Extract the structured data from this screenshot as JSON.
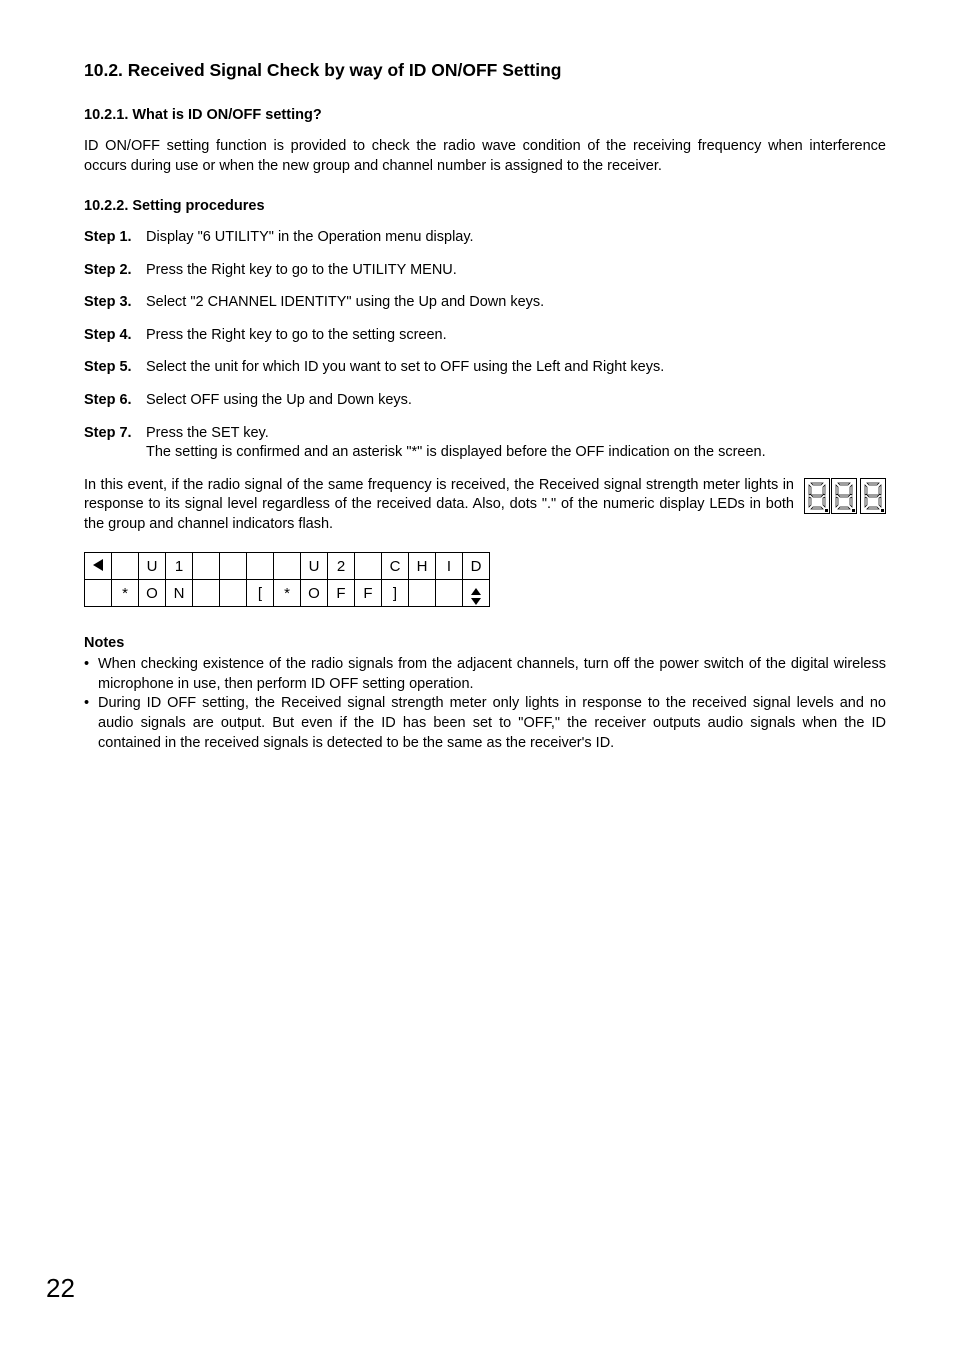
{
  "section_title": "10.2. Received Signal Check by way of ID ON/OFF Setting",
  "sub1": {
    "heading": "10.2.1. What is ID ON/OFF setting?",
    "text": "ID ON/OFF setting function is provided to check the radio wave condition of the receiving frequency when interference occurs during use or when the new group and channel number is assigned to the receiver."
  },
  "sub2": {
    "heading": "10.2.2. Setting procedures",
    "steps": [
      {
        "label": "Step 1.",
        "text": "Display \"6 UTILITY\" in the Operation menu display."
      },
      {
        "label": "Step 2.",
        "text": "Press the Right key to go to the UTILITY MENU."
      },
      {
        "label": "Step 3.",
        "text": "Select \"2 CHANNEL IDENTITY\" using the Up and Down keys."
      },
      {
        "label": "Step 4.",
        "text": "Press the Right key to go to the setting screen."
      },
      {
        "label": "Step 5.",
        "text": "Select the unit for which ID you want to set to OFF using the Left and Right keys."
      },
      {
        "label": "Step 6.",
        "text": "Select OFF using the Up and Down keys."
      },
      {
        "label": "Step 7.",
        "text": "Press the SET key.",
        "extra": "The setting is confirmed and an asterisk \"*\" is displayed before the OFF indication on the screen."
      }
    ],
    "after_text": "In this event, if the radio signal of the same frequency is received, the Received signal strength meter lights in response to its signal level regardless of the received data. Also, dots \".\" of the numeric display LEDs in both the group and channel indicators flash."
  },
  "lcd": {
    "row1": [
      "◀",
      "",
      "U",
      "1",
      "",
      "",
      "",
      "",
      "U",
      "2",
      "",
      "C",
      "H",
      "I",
      "D"
    ],
    "row2": [
      "",
      "*",
      "O",
      "N",
      "",
      "",
      "[",
      "*",
      "O",
      "F",
      "F",
      "]",
      "",
      "",
      "▲▼"
    ]
  },
  "notes": {
    "heading": "Notes",
    "items": [
      "When checking existence of the radio signals from the adjacent channels, turn off the power switch of the digital wireless microphone in use, then perform ID OFF setting operation.",
      "During ID OFF setting, the Received signal strength meter only lights in response to the received signal levels and no audio signals are output. But even if the ID has been set to \"OFF,\" the receiver outputs audio signals when the ID contained in the received signals is detected to be the same as the receiver's ID."
    ]
  },
  "page_number": "22"
}
